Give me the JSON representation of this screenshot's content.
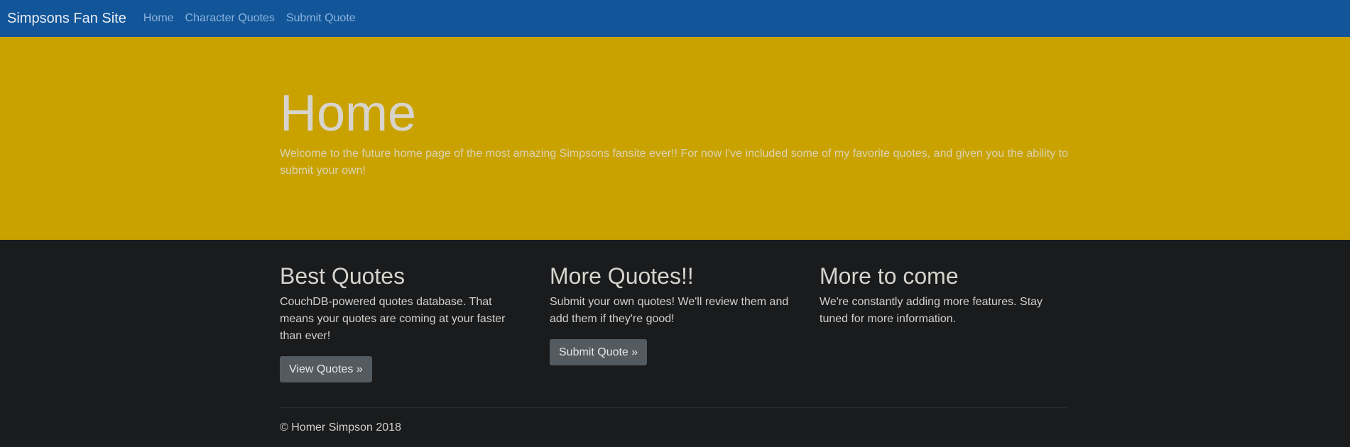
{
  "navbar": {
    "brand": "Simpsons Fan Site",
    "links": [
      "Home",
      "Character Quotes",
      "Submit Quote"
    ]
  },
  "jumbotron": {
    "title": "Home",
    "lead": "Welcome to the future home page of the most amazing Simpsons fansite ever!! For now I've included some of my favorite quotes, and given you the ability to submit your own!"
  },
  "columns": [
    {
      "heading": "Best Quotes",
      "text": "CouchDB-powered quotes database. That means your quotes are coming at your faster than ever!",
      "button": "View Quotes »"
    },
    {
      "heading": "More Quotes!!",
      "text": "Submit your own quotes! We'll review them and add them if they're good!",
      "button": "Submit Quote »"
    },
    {
      "heading": "More to come",
      "text": "We're constantly adding more features. Stay tuned for more information."
    }
  ],
  "footer": {
    "text": "© Homer Simpson 2018"
  },
  "colors": {
    "navbar": "#125699",
    "jumbotron": "#c9a200",
    "body": "#1a1b1d",
    "button": "#535a60"
  }
}
